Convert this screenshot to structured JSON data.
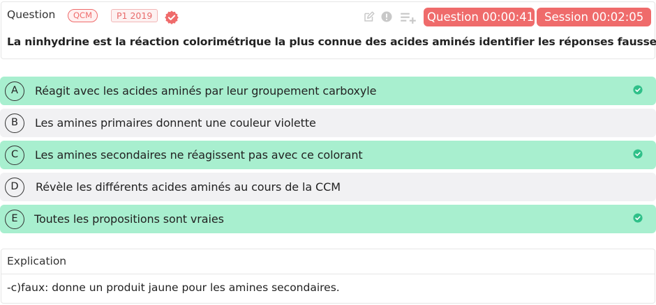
{
  "question": {
    "title": "Question",
    "badge_type": "QCM",
    "badge_year": "P1 2019",
    "timer_question": "Question 00:00:41",
    "timer_session": "Session 00:02:05",
    "text": "La ninhydrine est la réaction colorimétrique la plus connue des acides aminés identifier les réponses fausses :",
    "icons": [
      "verified-badge-icon",
      "edit-icon",
      "report-icon",
      "add-to-playlist-icon"
    ]
  },
  "options": [
    {
      "letter": "A",
      "text": "Réagit avec les acides aminés par leur groupement carboxyle",
      "state": "correct"
    },
    {
      "letter": "B",
      "text": "Les amines primaires donnent une couleur violette",
      "state": "neutral"
    },
    {
      "letter": "C",
      "text": "Les amines secondaires ne réagissent pas avec ce colorant",
      "state": "correct"
    },
    {
      "letter": "D",
      "text": "Révèle les différents acides aminés au cours de la CCM",
      "state": "neutral"
    },
    {
      "letter": "E",
      "text": "Toutes les propositions sont vraies",
      "state": "correct"
    }
  ],
  "explanation": {
    "title": "Explication",
    "text": "-c)faux: donne un produit jaune pour les amines secondaires."
  },
  "colors": {
    "accent": "#ef6b6b",
    "correct_bg": "#a8efcf",
    "neutral_bg": "#f1f1f3",
    "check": "#2fc089"
  }
}
